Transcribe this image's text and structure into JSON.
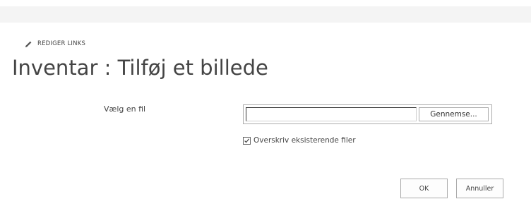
{
  "nav": {
    "edit_links_label": "REDIGER LINKS",
    "edit_icon": "pencil-icon"
  },
  "page": {
    "title": "Inventar : Tilføj et billede"
  },
  "form": {
    "file_label": "Vælg en fil",
    "file_value": "",
    "browse_label": "Gennemse...",
    "overwrite_label": "Overskriv eksisterende filer",
    "overwrite_checked": true
  },
  "actions": {
    "ok_label": "OK",
    "cancel_label": "Annuller"
  },
  "colors": {
    "text": "#444444",
    "border": "#ababab",
    "top_bar": "#f4f4f4"
  }
}
